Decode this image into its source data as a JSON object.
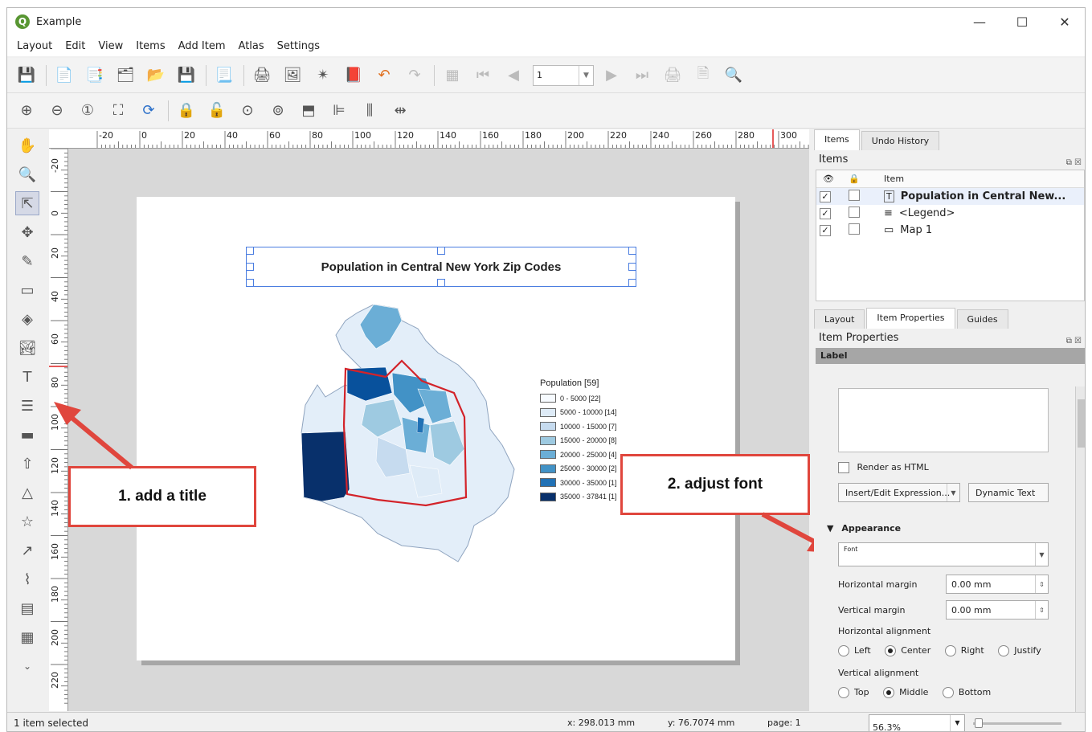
{
  "window": {
    "title": "Example",
    "min": "—",
    "max": "☐",
    "close": "✕"
  },
  "menu": [
    "Layout",
    "Edit",
    "View",
    "Items",
    "Add Item",
    "Atlas",
    "Settings"
  ],
  "toolbar": {
    "page_value": "1"
  },
  "ruler": {
    "h_labels": [
      "-20",
      "0",
      "20",
      "40",
      "60",
      "80",
      "100",
      "120",
      "140",
      "160",
      "180",
      "200",
      "220",
      "240",
      "260",
      "280",
      "300"
    ],
    "v_labels": [
      "-20",
      "0",
      "20",
      "40",
      "60",
      "80",
      "100",
      "120",
      "140",
      "160",
      "180",
      "200",
      "220"
    ]
  },
  "layout": {
    "title": "Population in Central New York Zip Codes",
    "legend_title": "Population [59]",
    "legend": [
      {
        "label": "0 - 5000 [22]",
        "color": "#f7fbff"
      },
      {
        "label": "5000 - 10000 [14]",
        "color": "#deebf7"
      },
      {
        "label": "10000 - 15000 [7]",
        "color": "#c6dbef"
      },
      {
        "label": "15000 - 20000 [8]",
        "color": "#9ecae1"
      },
      {
        "label": "20000 - 25000 [4]",
        "color": "#6baed6"
      },
      {
        "label": "25000 - 30000 [2]",
        "color": "#4292c6"
      },
      {
        "label": "30000 - 35000 [1]",
        "color": "#2171b5"
      },
      {
        "label": "35000 - 37841 [1]",
        "color": "#08306b"
      }
    ]
  },
  "callouts": {
    "first": "1. add a title",
    "second": "2. adjust font"
  },
  "panel": {
    "top_tabs": [
      "Items",
      "Undo History"
    ],
    "items_title": "Items",
    "item_col": "Item",
    "items": [
      {
        "name": "Population in Central New...",
        "icon": "T"
      },
      {
        "name": "<Legend>",
        "icon": "≡"
      },
      {
        "name": "Map 1",
        "icon": "▭"
      }
    ],
    "bottom_tabs": [
      "Layout",
      "Item Properties",
      "Guides"
    ],
    "props_title": "Item Properties",
    "section": "Label",
    "render_html": "Render as HTML",
    "insert_expr": "Insert/Edit Expression...",
    "dynamic_text": "Dynamic Text",
    "appearance": "Appearance",
    "font_label": "Font",
    "h_margin_label": "Horizontal margin",
    "h_margin": "0.00 mm",
    "v_margin_label": "Vertical margin",
    "v_margin": "0.00 mm",
    "h_align_label": "Horizontal alignment",
    "h_align": [
      "Left",
      "Center",
      "Right",
      "Justify"
    ],
    "v_align_label": "Vertical alignment",
    "v_align": [
      "Top",
      "Middle",
      "Bottom"
    ]
  },
  "status": {
    "selected": "1 item selected",
    "x": "x: 298.013 mm",
    "y": "y: 76.7074 mm",
    "page": "page: 1",
    "zoom": "56.3%"
  }
}
